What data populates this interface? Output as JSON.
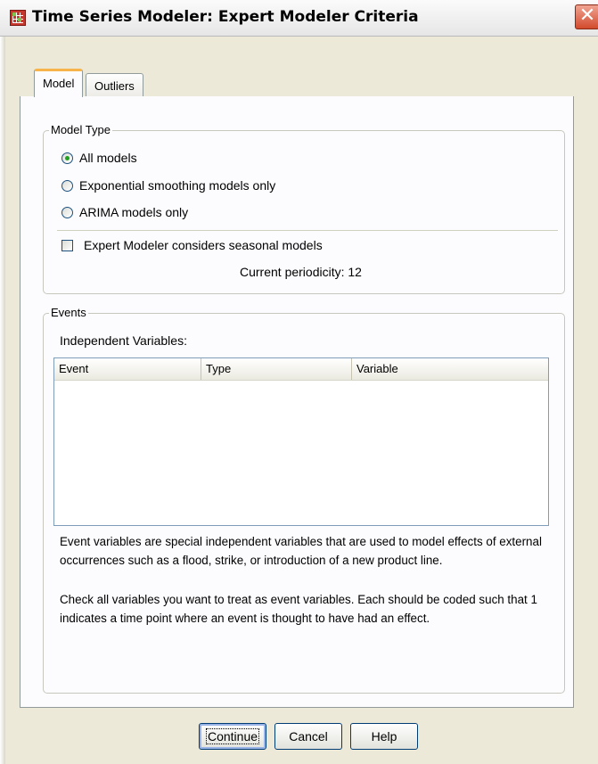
{
  "window": {
    "title": "Time Series Modeler: Expert Modeler Criteria",
    "close_glyph": "✕"
  },
  "tabs": [
    {
      "label": "Model",
      "active": true
    },
    {
      "label": "Outliers",
      "active": false
    }
  ],
  "model_type": {
    "label": "Model Type",
    "options": [
      {
        "label": "All models",
        "selected": true
      },
      {
        "label": "Exponential smoothing models only",
        "selected": false
      },
      {
        "label": "ARIMA models only",
        "selected": false
      }
    ],
    "seasonal_checkbox": {
      "label": "Expert Modeler considers seasonal models",
      "checked": false
    },
    "periodicity": "Current periodicity: 12"
  },
  "events": {
    "label": "Events",
    "independent_label": "Independent Variables:",
    "columns": [
      "Event",
      "Type",
      "Variable"
    ],
    "rows": [],
    "description_1": "Event variables are special independent variables that are used to model effects of external occurrences such as a flood, strike, or introduction of a new product line.",
    "description_2": "Check all variables you want to treat as event variables. Each should be coded such that 1 indicates a time point where an event is thought to have had an effect."
  },
  "buttons": {
    "continue": "Continue",
    "cancel": "Cancel",
    "help": "Help"
  },
  "colors": {
    "dialog_bg": "#ece9d8",
    "tab_active_accent": "#f7b44a",
    "close_button": "#d24a2c"
  },
  "icons": [
    "app-grid-icon",
    "close-icon",
    "radio-icon",
    "checkbox-icon"
  ]
}
